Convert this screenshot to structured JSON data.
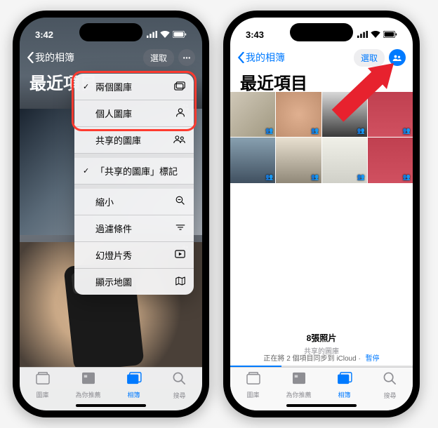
{
  "left": {
    "time": "3:42",
    "back_label": "我的相簿",
    "select_label": "選取",
    "title": "最近項目",
    "menu": {
      "both_libraries": "兩個圖庫",
      "personal_library": "個人圖庫",
      "shared_library": "共享的圖庫",
      "shared_badge": "「共享的圖庫」標記",
      "zoom_out": "縮小",
      "filter": "過濾條件",
      "slideshow": "幻燈片秀",
      "show_map": "顯示地圖"
    }
  },
  "right": {
    "time": "3:43",
    "back_label": "我的相簿",
    "select_label": "選取",
    "title": "最近項目",
    "count_label": "8張照片",
    "subtitle": "共享的圖庫",
    "sync_text": "正在將 2 個項目同步到 iCloud",
    "pause_label": "暫停"
  },
  "tabs": {
    "library": "圖庫",
    "for_you": "為你推薦",
    "albums": "相簿",
    "search": "搜尋"
  }
}
